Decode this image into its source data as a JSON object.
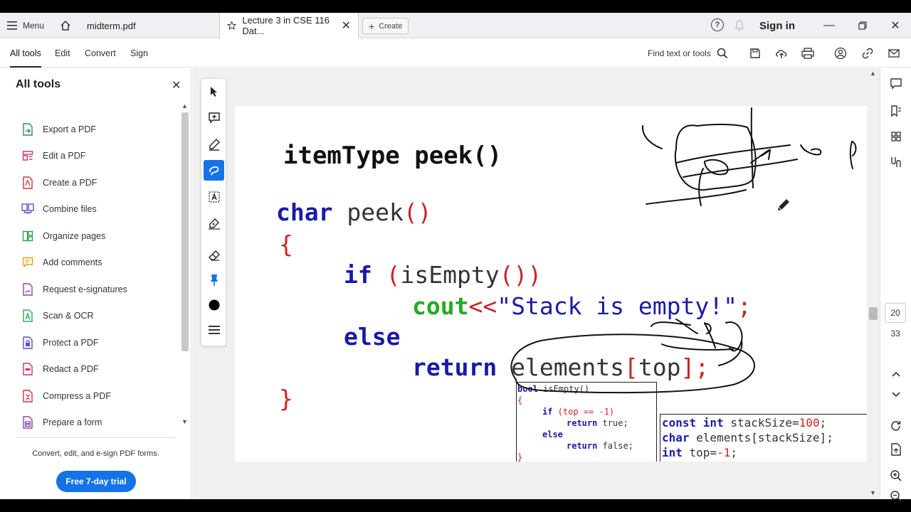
{
  "titlebar": {
    "menu_label": "Menu",
    "tab_midterm": "midterm.pdf",
    "tab_active": "Lecture 3 in CSE 116 Dat...",
    "create_label": "Create",
    "sign_in": "Sign in"
  },
  "toolbar": {
    "all_tools": "All tools",
    "edit": "Edit",
    "convert": "Convert",
    "sign": "Sign",
    "find": "Find text or tools"
  },
  "left_panel": {
    "title": "All tools",
    "items": [
      {
        "label": "Export a PDF",
        "icon": "export-pdf-icon",
        "color": "#2a8c6d"
      },
      {
        "label": "Edit a PDF",
        "icon": "edit-pdf-icon",
        "color": "#c8336b"
      },
      {
        "label": "Create a PDF",
        "icon": "create-pdf-icon",
        "color": "#d0323b"
      },
      {
        "label": "Combine files",
        "icon": "combine-files-icon",
        "color": "#5a4fcf"
      },
      {
        "label": "Organize pages",
        "icon": "organize-pages-icon",
        "color": "#2f9e44"
      },
      {
        "label": "Add comments",
        "icon": "add-comments-icon",
        "color": "#e5a50a"
      },
      {
        "label": "Request e-signatures",
        "icon": "request-esign-icon",
        "color": "#8e44ad"
      },
      {
        "label": "Scan & OCR",
        "icon": "scan-ocr-icon",
        "color": "#27ae60"
      },
      {
        "label": "Protect a PDF",
        "icon": "protect-pdf-icon",
        "color": "#5a4fcf"
      },
      {
        "label": "Redact a PDF",
        "icon": "redact-pdf-icon",
        "color": "#c8336b"
      },
      {
        "label": "Compress a PDF",
        "icon": "compress-pdf-icon",
        "color": "#d0323b"
      },
      {
        "label": "Prepare a form",
        "icon": "prepare-form-icon",
        "color": "#8e44ad"
      }
    ],
    "promo": "Convert, edit, and e-sign PDF forms.",
    "trial_button": "Free 7-day trial"
  },
  "document": {
    "heading": "itemType peek()",
    "code": {
      "sig_type": "char",
      "sig_name": " peek",
      "sig_parens": "()",
      "open_brace": "{",
      "if_kw": "if",
      "if_open": " (",
      "if_call": "isEmpty",
      "if_parens": "())",
      "cout": "cout",
      "shift": "<<",
      "string": "\"Stack is empty!\"",
      "semi": ";",
      "else_kw": "else",
      "return_kw": "return",
      "elements": " elements",
      "idx_open": "[",
      "idx": "top",
      "idx_close": "]",
      "ret_semi": ";",
      "close_brace": "}"
    },
    "isempty_box": {
      "line1_kw": "bool",
      "line1_rest": " isEmpty()",
      "line2": "{",
      "line3_kw": "if",
      "line3_rest": " (top == -1)",
      "line4_kw": "return",
      "line4_rest": " true;",
      "line5_kw": "else",
      "line6_kw": "return",
      "line6_rest": " false;",
      "line7": "}"
    },
    "decl_box": {
      "l1_kw": "const int",
      "l1_name": " stackSize=",
      "l1_val": "100",
      "l1_end": ";",
      "l2_kw": "char",
      "l2_rest": " elements[stackSize];",
      "l3_kw": "int",
      "l3_name": " top=",
      "l3_val": "-1",
      "l3_end": ";"
    }
  },
  "page_nav": {
    "current": "20",
    "total": "33"
  }
}
